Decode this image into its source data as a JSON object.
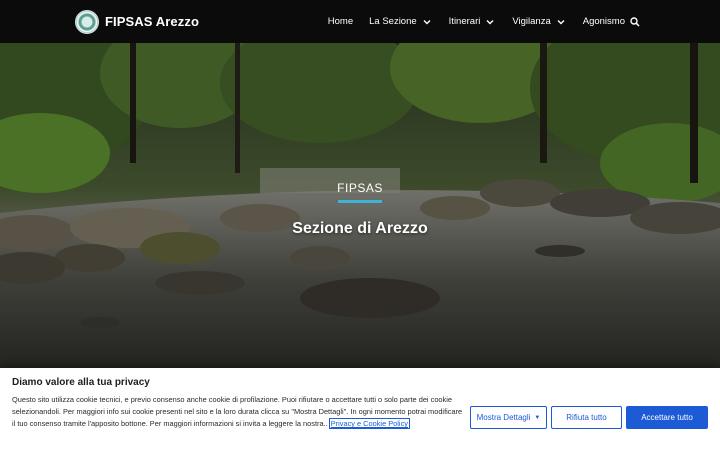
{
  "header": {
    "brand": "FIPSAS Arezzo",
    "nav": [
      {
        "label": "Home"
      },
      {
        "label": "La Sezione"
      },
      {
        "label": "Itinerari"
      },
      {
        "label": "Vigilanza"
      },
      {
        "label": "Agonismo"
      }
    ]
  },
  "hero": {
    "kicker": "FIPSAS",
    "title": "Sezione di Arezzo",
    "accent_color": "#3fb3d6"
  },
  "cookie": {
    "title": "Diamo valore alla tua privacy",
    "text": "Questo sito utilizza cookie tecnici, e previo consenso anche cookie di profilazione. Puoi rifiutare o accettare tutti o solo parte dei cookie selezionandoli. Per maggiori info sui cookie presenti nel sito e la loro durata clicca su \"Mostra Dettagli\". In ogni momento potrai modificare il tuo consenso tramite l'apposito bottone. Per maggiori informazioni si invita a leggere la nostra.. ",
    "link": "Privacy e Cookie Policy",
    "buttons": {
      "details": "Mostra Dettagli",
      "refuse": "Rifiuta tutto",
      "accept": "Accettare tutto"
    },
    "accent_color": "#1d5ad6"
  }
}
